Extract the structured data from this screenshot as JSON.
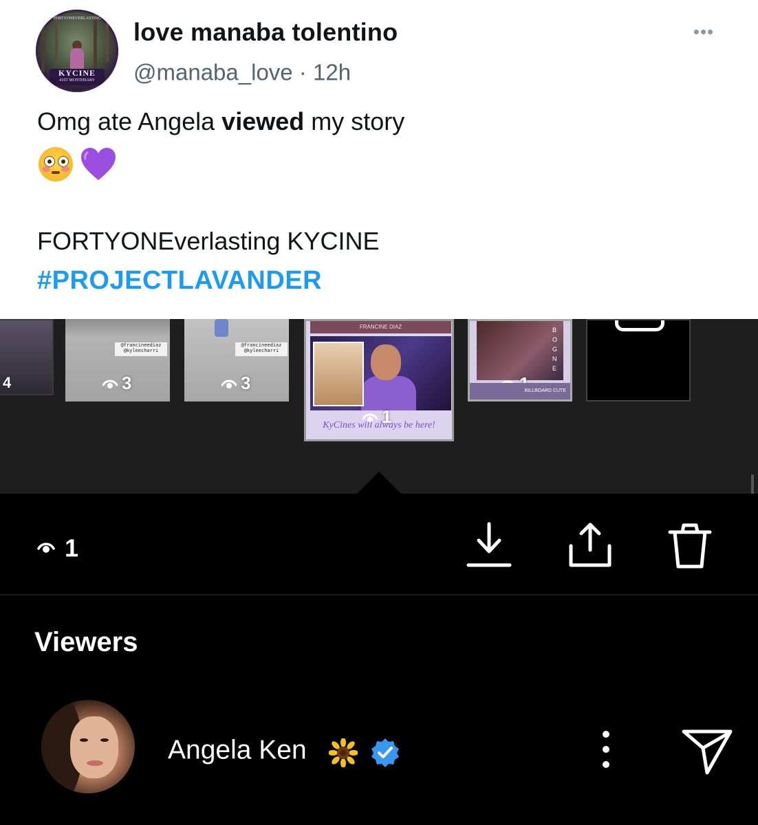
{
  "tweet": {
    "avatar": {
      "badge_title": "KYCINE",
      "badge_subtitle": "41ST MONTHSARY",
      "badge_topline": "FORTYONEVERLASTING"
    },
    "display_name": "love manaba tolentino",
    "handle": "@manaba_love",
    "separator": "·",
    "time": "12h",
    "text_before": "Omg ate Angela ",
    "text_bold": "viewed",
    "text_after": " my story",
    "emojis": [
      "flushed-face",
      "purple-heart"
    ],
    "line2": "FORTYONEverlasting KYCINE",
    "hashtag": "#PROJECTLAVANDER",
    "colors": {
      "hashtag": "#1d9bf0",
      "meta": "#536471",
      "text": "#0f1419"
    }
  },
  "story_strip": {
    "edge_count": "4",
    "thumbs": [
      {
        "sticker_line1": "@francineediaz",
        "sticker_line2": "@kyleecharri",
        "views": "3"
      },
      {
        "sticker_line1": "@francineediaz",
        "sticker_line2": "@kyleecharri",
        "views": "3"
      },
      {
        "topbar": "FRANCINE DIAZ",
        "banner": "KyCines will always be here!",
        "views": "1"
      },
      {
        "vertical_text": "BOGNE",
        "footer": "BILLBOARD CUTE",
        "views": "1"
      },
      {
        "type": "camera"
      }
    ]
  },
  "actions": {
    "views": "1",
    "download_icon": "download-icon",
    "share_icon": "share-icon",
    "delete_icon": "trash-icon"
  },
  "viewers": {
    "title": "Viewers",
    "list": [
      {
        "name": "Angela Ken",
        "emoji": "sunflower",
        "verified": true
      }
    ]
  }
}
